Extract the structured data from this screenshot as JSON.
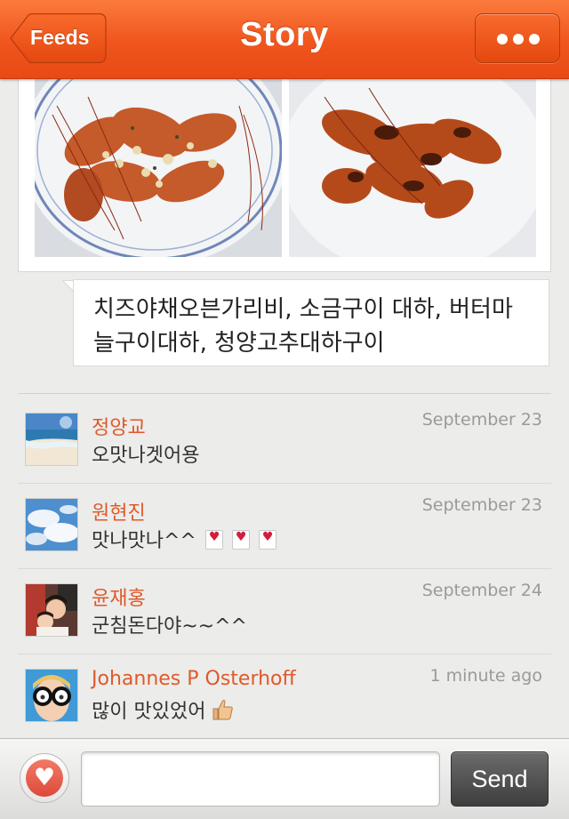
{
  "nav": {
    "title": "Story",
    "back_label": "Feeds",
    "more_icon": "ellipsis-icon"
  },
  "post": {
    "caption": "치즈야채오븐가리비, 소금구이 대하, 버터마늘구이대하, 청양고추대하구이"
  },
  "comments": [
    {
      "name": "정양교",
      "date": "September 23",
      "text": "오맛나겟어용",
      "extras": []
    },
    {
      "name": "원현진",
      "date": "September 23",
      "text": "맛나맛나^^",
      "extras": [
        "heart-emoji",
        "heart-emoji",
        "heart-emoji"
      ]
    },
    {
      "name": "윤재홍",
      "date": "September 24",
      "text": "군침돈다야~~^^",
      "extras": []
    },
    {
      "name": "Johannes P Osterhoff",
      "date": "1 minute ago",
      "text": "많이 맛있었어",
      "extras": [
        "thumbs-up-emoji"
      ]
    }
  ],
  "composer": {
    "input_value": "",
    "send_label": "Send",
    "like_icon": "heart-icon"
  },
  "colors": {
    "nav_orange": "#f0551e",
    "comment_name": "#e0592a",
    "date_gray": "#9a9a9a",
    "send_button": "#4a4a4a"
  }
}
